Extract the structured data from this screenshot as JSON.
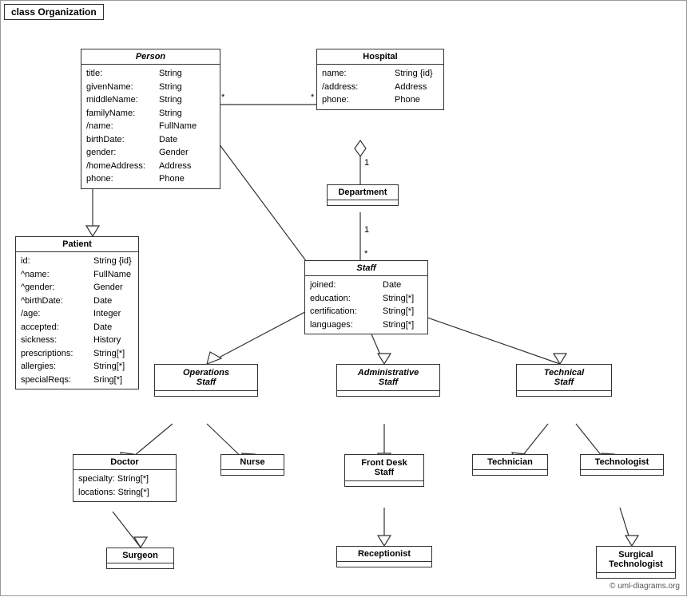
{
  "title": "class Organization",
  "classes": {
    "person": {
      "name": "Person",
      "italic": true,
      "attrs": [
        {
          "name": "title:",
          "type": "String"
        },
        {
          "name": "givenName:",
          "type": "String"
        },
        {
          "name": "middleName:",
          "type": "String"
        },
        {
          "name": "familyName:",
          "type": "String"
        },
        {
          "name": "/name:",
          "type": "FullName"
        },
        {
          "name": "birthDate:",
          "type": "Date"
        },
        {
          "name": "gender:",
          "type": "Gender"
        },
        {
          "name": "/homeAddress:",
          "type": "Address"
        },
        {
          "name": "phone:",
          "type": "Phone"
        }
      ]
    },
    "hospital": {
      "name": "Hospital",
      "italic": false,
      "attrs": [
        {
          "name": "name:",
          "type": "String {id}"
        },
        {
          "name": "/address:",
          "type": "Address"
        },
        {
          "name": "phone:",
          "type": "Phone"
        }
      ]
    },
    "department": {
      "name": "Department",
      "italic": false,
      "attrs": []
    },
    "staff": {
      "name": "Staff",
      "italic": true,
      "attrs": [
        {
          "name": "joined:",
          "type": "Date"
        },
        {
          "name": "education:",
          "type": "String[*]"
        },
        {
          "name": "certification:",
          "type": "String[*]"
        },
        {
          "name": "languages:",
          "type": "String[*]"
        }
      ]
    },
    "patient": {
      "name": "Patient",
      "italic": false,
      "attrs": [
        {
          "name": "id:",
          "type": "String {id}"
        },
        {
          "name": "^name:",
          "type": "FullName"
        },
        {
          "name": "^gender:",
          "type": "Gender"
        },
        {
          "name": "^birthDate:",
          "type": "Date"
        },
        {
          "name": "/age:",
          "type": "Integer"
        },
        {
          "name": "accepted:",
          "type": "Date"
        },
        {
          "name": "sickness:",
          "type": "History"
        },
        {
          "name": "prescriptions:",
          "type": "String[*]"
        },
        {
          "name": "allergies:",
          "type": "String[*]"
        },
        {
          "name": "specialReqs:",
          "type": "Sring[*]"
        }
      ]
    },
    "ops_staff": {
      "name": "Operations\nStaff",
      "italic": true,
      "attrs": []
    },
    "admin_staff": {
      "name": "Administrative\nStaff",
      "italic": true,
      "attrs": []
    },
    "tech_staff": {
      "name": "Technical\nStaff",
      "italic": true,
      "attrs": []
    },
    "doctor": {
      "name": "Doctor",
      "italic": false,
      "attrs": [
        {
          "name": "specialty:",
          "type": "String[*]"
        },
        {
          "name": "locations:",
          "type": "String[*]"
        }
      ]
    },
    "nurse": {
      "name": "Nurse",
      "italic": false,
      "attrs": []
    },
    "front_desk": {
      "name": "Front Desk\nStaff",
      "italic": false,
      "attrs": []
    },
    "technician": {
      "name": "Technician",
      "italic": false,
      "attrs": []
    },
    "technologist": {
      "name": "Technologist",
      "italic": false,
      "attrs": []
    },
    "surgeon": {
      "name": "Surgeon",
      "italic": false,
      "attrs": []
    },
    "receptionist": {
      "name": "Receptionist",
      "italic": false,
      "attrs": []
    },
    "surgical_tech": {
      "name": "Surgical\nTechnologist",
      "italic": false,
      "attrs": []
    }
  },
  "copyright": "© uml-diagrams.org"
}
